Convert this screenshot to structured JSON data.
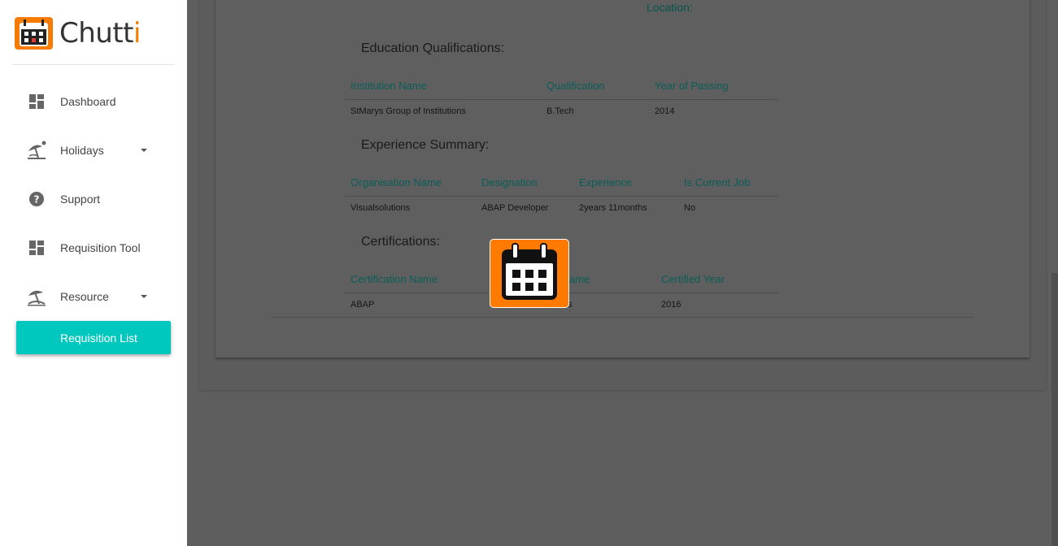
{
  "app": {
    "logo_text_main": "Chutt",
    "logo_text_accent": "i"
  },
  "sidebar": {
    "items": [
      {
        "label": "Dashboard",
        "icon": "dashboard-icon"
      },
      {
        "label": "Holidays",
        "icon": "beach-icon",
        "has_caret": true
      },
      {
        "label": "Support",
        "icon": "help-icon"
      },
      {
        "label": "Requisition Tool",
        "icon": "dashboard-icon"
      },
      {
        "label": "Resource",
        "icon": "beach-icon",
        "has_caret": true
      }
    ],
    "active_subitem": "Requisition List"
  },
  "profile": {
    "location_label": "Location:",
    "education": {
      "title": "Education Qualifications:",
      "headers": [
        "Institution Name",
        "Qualification",
        "Year of Passing"
      ],
      "rows": [
        [
          "StMarys Group of Institutions",
          "B.Tech",
          "2014"
        ]
      ]
    },
    "experience": {
      "title": "Experience Summary:",
      "headers": [
        "Organisation Name",
        "Designation",
        "Experience",
        "Is Current Job"
      ],
      "rows": [
        [
          "Visualsolutions",
          "ABAP Developer",
          "2years 11months",
          "No"
        ]
      ]
    },
    "certifications": {
      "title": "Certifications:",
      "headers": [
        "Certification Name",
        "ame",
        "Certified Year"
      ],
      "rows": [
        [
          "ABAP",
          "us",
          "2016"
        ]
      ]
    }
  },
  "colors": {
    "accent": "#00c8be",
    "brand": "#f57c00",
    "overlay": "#5e5e5e"
  }
}
